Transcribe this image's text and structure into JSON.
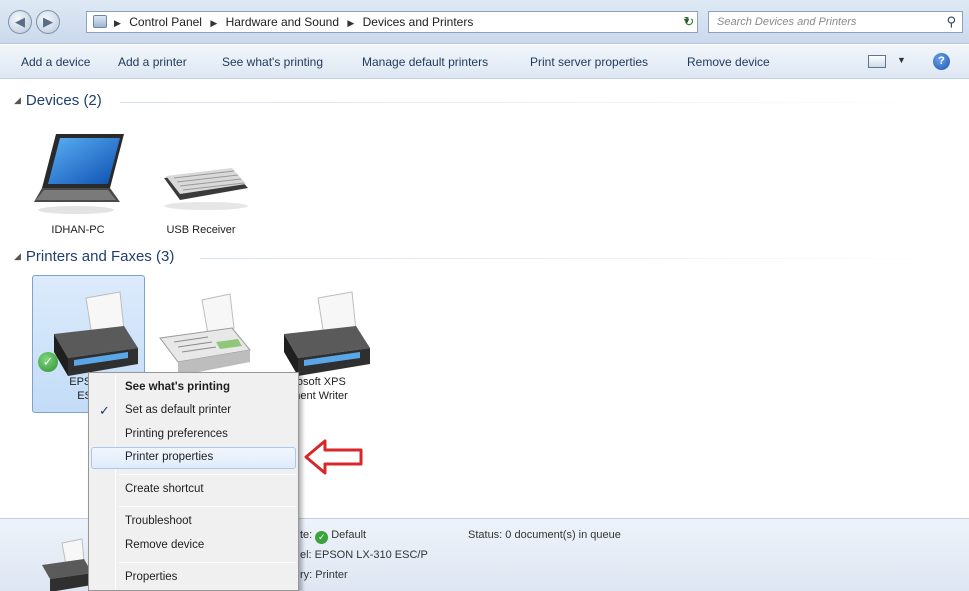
{
  "address": {
    "crumbs": [
      "Control Panel",
      "Hardware and Sound",
      "Devices and Printers"
    ],
    "search_placeholder": "Search Devices and Printers"
  },
  "toolbar": {
    "add_device": "Add a device",
    "add_printer": "Add a printer",
    "see_printing": "See what's printing",
    "manage_default": "Manage default printers",
    "print_server": "Print server properties",
    "remove_device": "Remove device"
  },
  "groups": {
    "devices": "Devices (2)",
    "printers": "Printers and Faxes (3)"
  },
  "devices": [
    {
      "label": "IDHAN-PC",
      "icon": "laptop-icon"
    },
    {
      "label": "USB Receiver",
      "icon": "keyboard-icon"
    }
  ],
  "printers": [
    {
      "line1": "EPSON",
      "line2": "ESC",
      "icon": "printer-icon",
      "default": true
    },
    {
      "line1": "",
      "line2": "",
      "icon": "fax-icon"
    },
    {
      "line1": "rosoft XPS",
      "line2": "ment Writer",
      "icon": "printer-icon"
    }
  ],
  "context_menu": {
    "see_printing": "See what's printing",
    "set_default": "Set as default printer",
    "printing_prefs": "Printing preferences",
    "printer_props": "Printer properties",
    "create_shortcut": "Create shortcut",
    "troubleshoot": "Troubleshoot",
    "remove_device": "Remove device",
    "properties": "Properties"
  },
  "details": {
    "state_prefix": "te:",
    "state_value": "Default",
    "status": "Status:  0 document(s) in queue",
    "model": "el:  EPSON LX-310 ESC/P",
    "category": "ry:  Printer"
  },
  "colors": {
    "accent": "#1e3f70",
    "selection": "#c3dcf7",
    "arrow": "#d8262b",
    "ok": "#3aa33a"
  }
}
